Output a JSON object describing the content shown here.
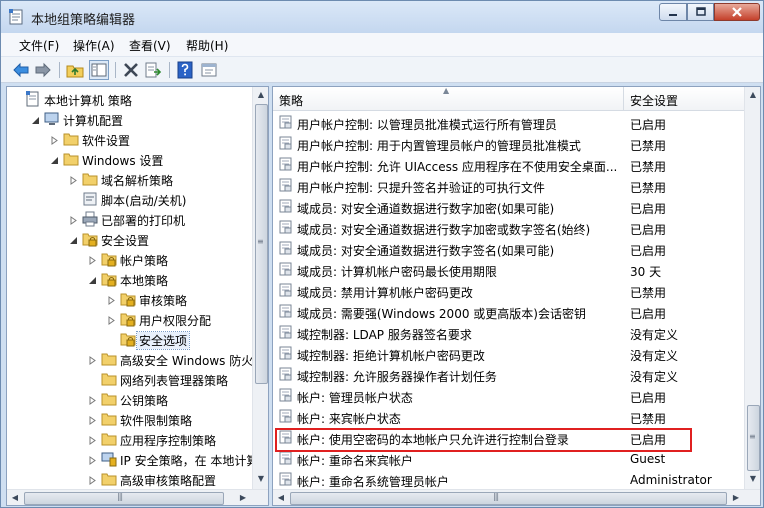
{
  "window": {
    "title": "本地组策略编辑器"
  },
  "menu": [
    "文件(F)",
    "操作(A)",
    "查看(V)",
    "帮助(H)"
  ],
  "toolbar_icons": [
    "back-icon",
    "forward-icon",
    "up-folder-icon",
    "show-tree-icon",
    "delete-icon",
    "export-list-icon",
    "help-icon",
    "properties-icon"
  ],
  "tree": [
    {
      "label": "本地计算机 策略",
      "level": 0,
      "icon": "computer-policy-icon",
      "expander": "none"
    },
    {
      "label": "计算机配置",
      "level": 1,
      "icon": "computer-icon",
      "expander": "expanded"
    },
    {
      "label": "软件设置",
      "level": 2,
      "icon": "folder-icon",
      "expander": "collapsed"
    },
    {
      "label": "Windows 设置",
      "level": 2,
      "icon": "folder-icon",
      "expander": "expanded"
    },
    {
      "label": "域名解析策略",
      "level": 3,
      "icon": "folder-icon",
      "expander": "collapsed"
    },
    {
      "label": "脚本(启动/关机)",
      "level": 3,
      "icon": "script-icon",
      "expander": "none"
    },
    {
      "label": "已部署的打印机",
      "level": 3,
      "icon": "printer-icon",
      "expander": "collapsed"
    },
    {
      "label": "安全设置",
      "level": 3,
      "icon": "security-folder-icon",
      "expander": "expanded"
    },
    {
      "label": "帐户策略",
      "level": 4,
      "icon": "security-folder-icon",
      "expander": "collapsed"
    },
    {
      "label": "本地策略",
      "level": 4,
      "icon": "security-folder-icon",
      "expander": "expanded"
    },
    {
      "label": "审核策略",
      "level": 5,
      "icon": "security-folder-icon",
      "expander": "collapsed"
    },
    {
      "label": "用户权限分配",
      "level": 5,
      "icon": "security-folder-icon",
      "expander": "collapsed"
    },
    {
      "label": "安全选项",
      "level": 5,
      "icon": "security-folder-icon",
      "expander": "none",
      "selected": true
    },
    {
      "label": "高级安全 Windows 防火墙",
      "level": 4,
      "icon": "folder-icon",
      "expander": "collapsed"
    },
    {
      "label": "网络列表管理器策略",
      "level": 4,
      "icon": "folder-icon",
      "expander": "none"
    },
    {
      "label": "公钥策略",
      "level": 4,
      "icon": "folder-icon",
      "expander": "collapsed"
    },
    {
      "label": "软件限制策略",
      "level": 4,
      "icon": "folder-icon",
      "expander": "collapsed"
    },
    {
      "label": "应用程序控制策略",
      "level": 4,
      "icon": "folder-icon",
      "expander": "collapsed"
    },
    {
      "label": "IP 安全策略，在 本地计算机",
      "level": 4,
      "icon": "ip-security-icon",
      "expander": "collapsed"
    },
    {
      "label": "高级审核策略配置",
      "level": 4,
      "icon": "folder-icon",
      "expander": "collapsed"
    }
  ],
  "list": {
    "columns": [
      "策略",
      "安全设置"
    ],
    "rows": [
      {
        "policy": "用户帐户控制: 以管理员批准模式运行所有管理员",
        "setting": "已启用"
      },
      {
        "policy": "用户帐户控制: 用于内置管理员帐户的管理员批准模式",
        "setting": "已禁用"
      },
      {
        "policy": "用户帐户控制: 允许 UIAccess 应用程序在不使用安全桌面...",
        "setting": "已禁用"
      },
      {
        "policy": "用户帐户控制: 只提升签名并验证的可执行文件",
        "setting": "已禁用"
      },
      {
        "policy": "域成员: 对安全通道数据进行数字加密(如果可能)",
        "setting": "已启用"
      },
      {
        "policy": "域成员: 对安全通道数据进行数字加密或数字签名(始终)",
        "setting": "已启用"
      },
      {
        "policy": "域成员: 对安全通道数据进行数字签名(如果可能)",
        "setting": "已启用"
      },
      {
        "policy": "域成员: 计算机帐户密码最长使用期限",
        "setting": "30 天"
      },
      {
        "policy": "域成员: 禁用计算机帐户密码更改",
        "setting": "已禁用"
      },
      {
        "policy": "域成员: 需要强(Windows 2000 或更高版本)会话密钥",
        "setting": "已启用"
      },
      {
        "policy": "域控制器: LDAP 服务器签名要求",
        "setting": "没有定义"
      },
      {
        "policy": "域控制器: 拒绝计算机帐户密码更改",
        "setting": "没有定义"
      },
      {
        "policy": "域控制器: 允许服务器操作者计划任务",
        "setting": "没有定义"
      },
      {
        "policy": "帐户: 管理员帐户状态",
        "setting": "已启用"
      },
      {
        "policy": "帐户: 来宾帐户状态",
        "setting": "已禁用"
      },
      {
        "policy": "帐户: 使用空密码的本地帐户只允许进行控制台登录",
        "setting": "已启用",
        "highlighted": true
      },
      {
        "policy": "帐户: 重命名来宾帐户",
        "setting": "Guest"
      },
      {
        "policy": "帐户: 重命名系统管理员帐户",
        "setting": "Administrator"
      }
    ]
  },
  "colors": {
    "highlight_border": "#e02020",
    "selection_bg": "#e8f0fb"
  }
}
